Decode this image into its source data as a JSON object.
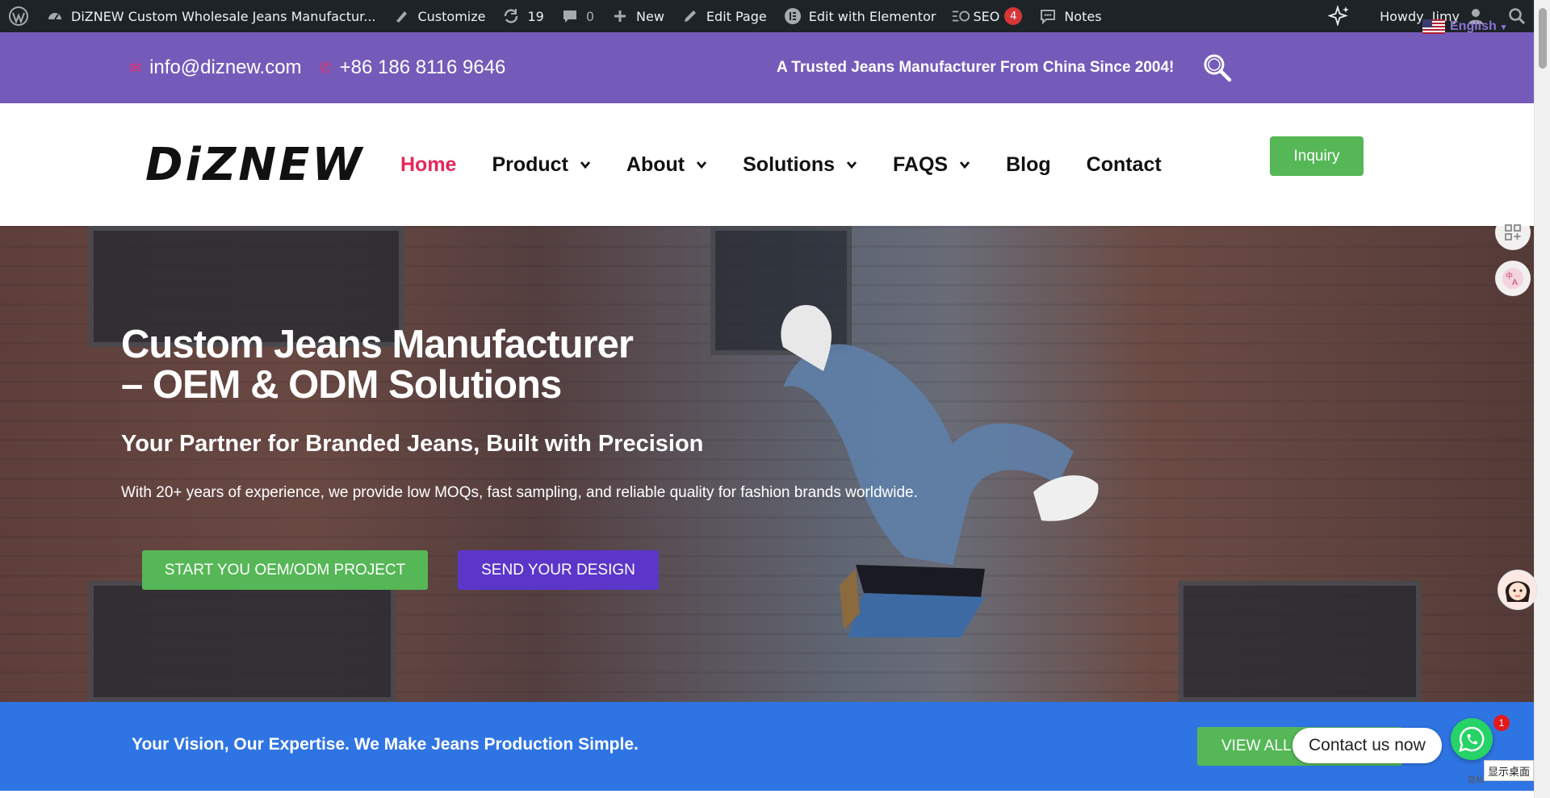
{
  "admin_bar": {
    "site_name": "DiZNEW Custom Wholesale Jeans Manufactur...",
    "customize": "Customize",
    "updates_count": "19",
    "comments_count": "0",
    "new_label": "New",
    "edit_page": "Edit Page",
    "elementor": "Edit with Elementor",
    "seo_label": "SEO",
    "seo_badge": "4",
    "notes": "Notes",
    "howdy": "Howdy, Jimy"
  },
  "topbar": {
    "email": "info@diznew.com",
    "phone": "+86 186 8116 9646",
    "tagline": "A Trusted Jeans Manufacturer From China Since 2004!",
    "language": "English",
    "bg_color": "#755bb9"
  },
  "nav": {
    "logo": "DiZNEW",
    "items": [
      {
        "label": "Home",
        "active": true,
        "dropdown": false
      },
      {
        "label": "Product",
        "active": false,
        "dropdown": true
      },
      {
        "label": "About",
        "active": false,
        "dropdown": true
      },
      {
        "label": "Solutions",
        "active": false,
        "dropdown": true
      },
      {
        "label": "FAQS",
        "active": false,
        "dropdown": true
      },
      {
        "label": "Blog",
        "active": false,
        "dropdown": false
      },
      {
        "label": "Contact",
        "active": false,
        "dropdown": false
      }
    ],
    "inquiry_label": "Inquiry",
    "active_color": "#e6265c"
  },
  "hero": {
    "title_line1": "Custom Jeans Manufacturer",
    "title_line2": "– OEM & ODM Solutions",
    "subtitle": "Your Partner for Branded Jeans, Built with Precision",
    "description": "With 20+ years of experience, we provide low MOQs, fast sampling, and reliable quality for fashion brands worldwide.",
    "cta_primary": "START YOU OEM/ODM PROJECT",
    "cta_secondary": "SEND YOUR DESIGN"
  },
  "bluebar": {
    "message": "Your Vision, Our Expertise. We Make Jeans Production Simple.",
    "view_all": "VIEW ALL",
    "bg_color": "#2f74e3"
  },
  "widget": {
    "contact_label": "Contact us now",
    "badge_count": "1",
    "desktop_label": "显示桌面",
    "tiny_label": "隐私"
  },
  "colors": {
    "green": "#55b756",
    "purple_button": "#5b36c9",
    "admin_bg": "#1d2327"
  }
}
